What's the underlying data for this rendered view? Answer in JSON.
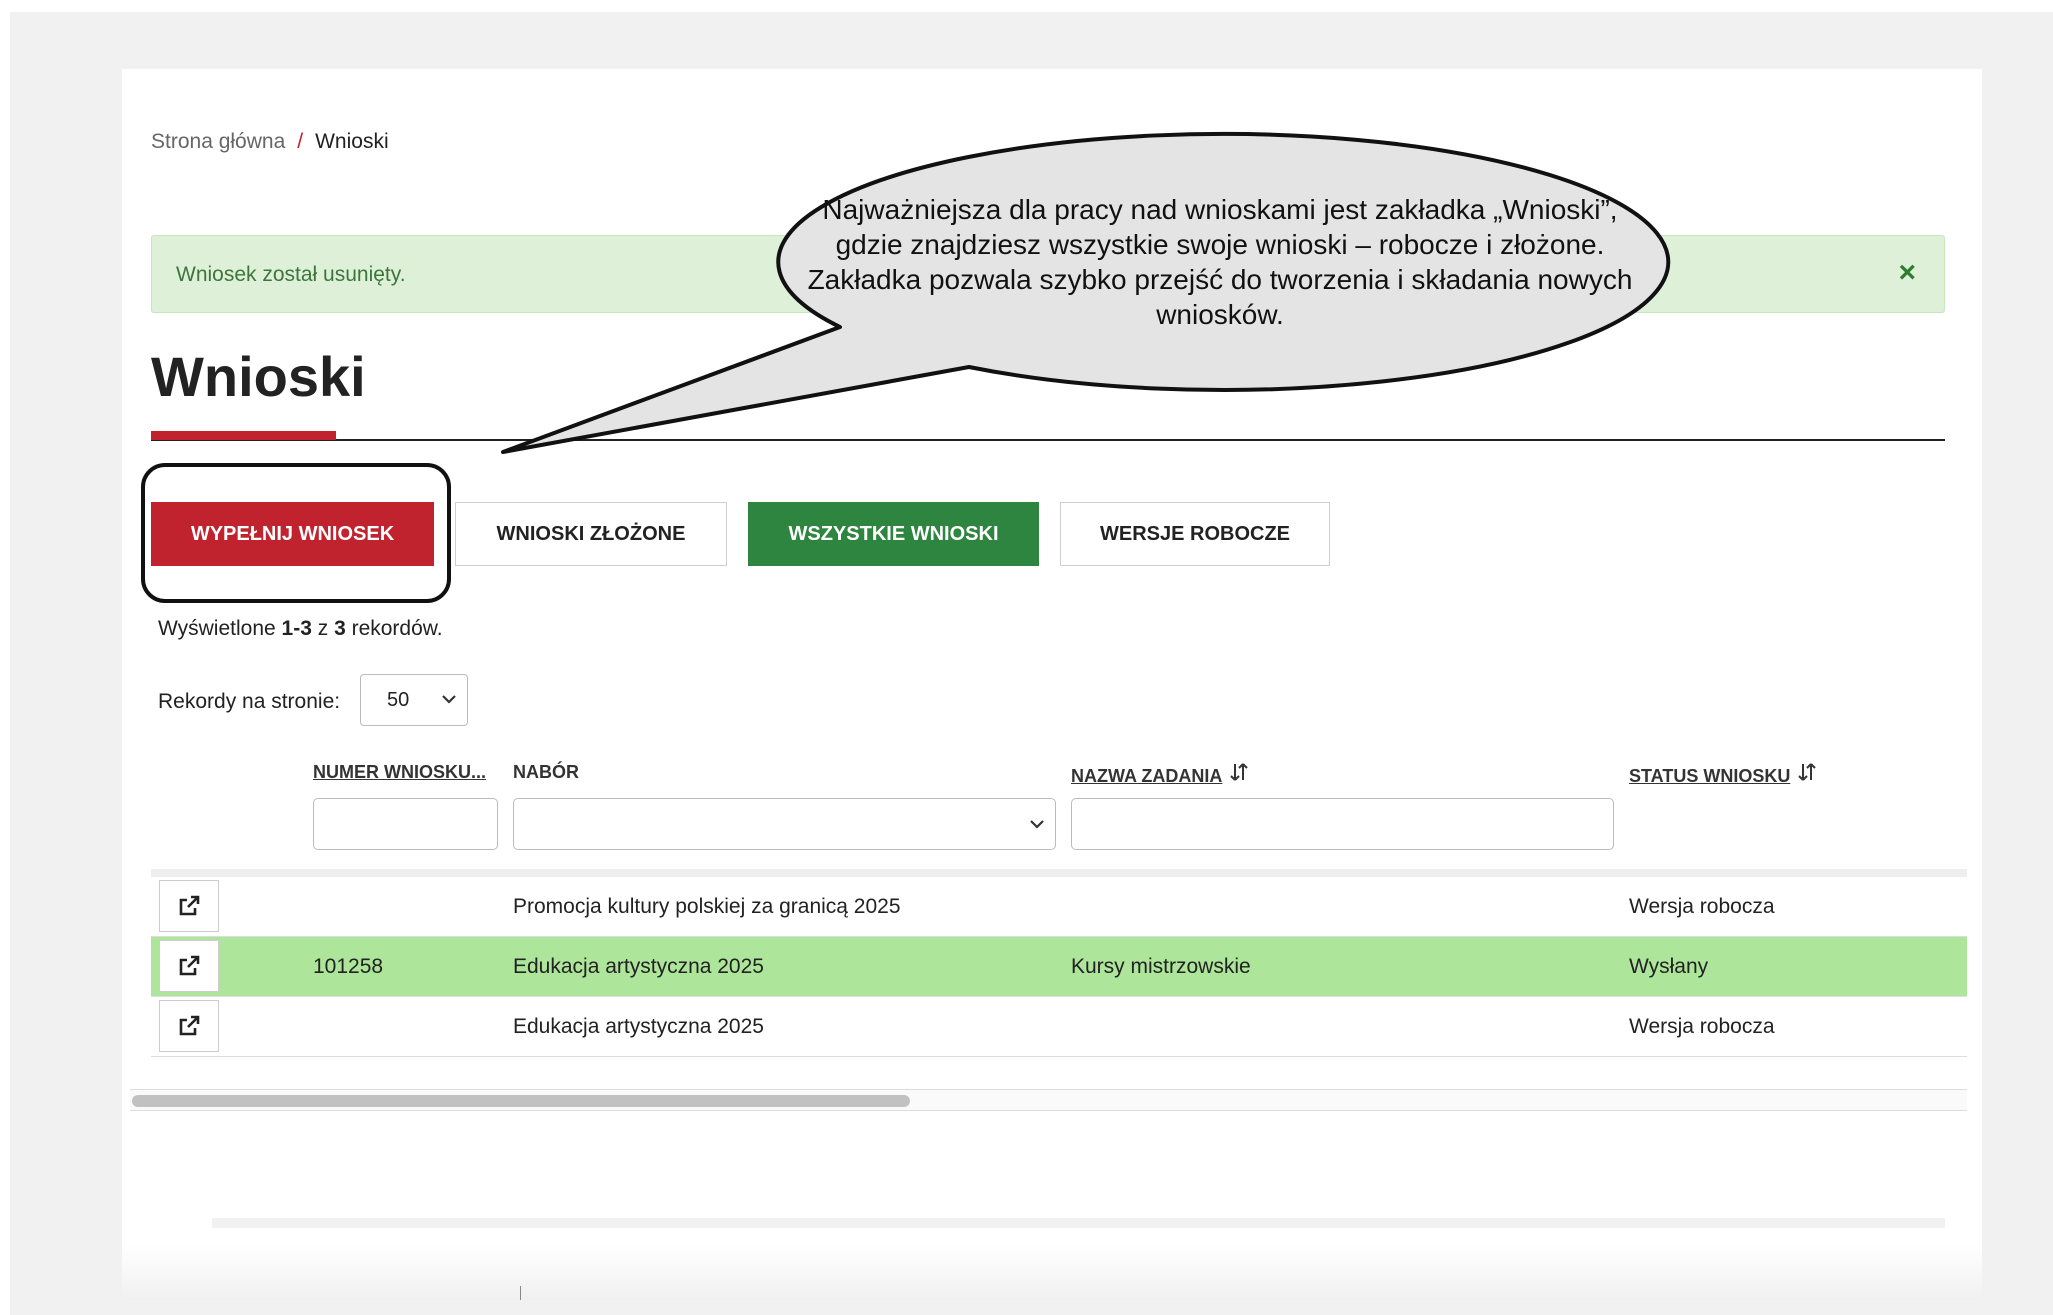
{
  "breadcrumb": {
    "home": "Strona główna",
    "separator": "/",
    "current": "Wnioski"
  },
  "alert": {
    "message": "Wniosek został usunięty.",
    "close": "×"
  },
  "page_title": "Wnioski",
  "buttons": {
    "fill": "WYPEŁNIJ WNIOSEK",
    "submitted": "WNIOSKI ZŁOŻONE",
    "all": "WSZYSTKIE WNIOSKI",
    "drafts": "WERSJE ROBOCZE"
  },
  "records_info": {
    "prefix": "Wyświetlone ",
    "range": "1-3",
    "middle": " z ",
    "total": "3",
    "suffix": " rekordów."
  },
  "per_page": {
    "label": "Rekordy na stronie:",
    "value": "50"
  },
  "table": {
    "columns": {
      "number": "NUMER WNIOSKU...",
      "nabor": "NABÓR",
      "task_name": "NAZWA ZADANIA",
      "status": "STATUS WNIOSKU"
    },
    "rows": [
      {
        "number": "",
        "nabor": "Promocja kultury polskiej za granicą 2025",
        "task_name": "",
        "status": "Wersja robocza"
      },
      {
        "number": "101258",
        "nabor": "Edukacja artystyczna 2025",
        "task_name": "Kursy mistrzowskie",
        "status": "Wysłany"
      },
      {
        "number": "",
        "nabor": "Edukacja artystyczna 2025",
        "task_name": "",
        "status": "Wersja robocza"
      }
    ]
  },
  "callout": "Najważniejsza dla pracy nad wnioskami jest zakładka „Wnioski”, gdzie znajdziesz wszystkie swoje wnioski – robocze i złożone. Zakładka  pozwala szybko przejść do tworzenia i składania nowych wniosków.",
  "colors": {
    "brand_red": "#c0232e",
    "green": "#2e8540",
    "row_selected": "#ade59a",
    "alert_bg": "#dff0d8"
  },
  "icons": {
    "open": "external-link-icon",
    "sort": "sort-icon",
    "chevron": "chevron-down-icon",
    "close": "close-icon"
  }
}
